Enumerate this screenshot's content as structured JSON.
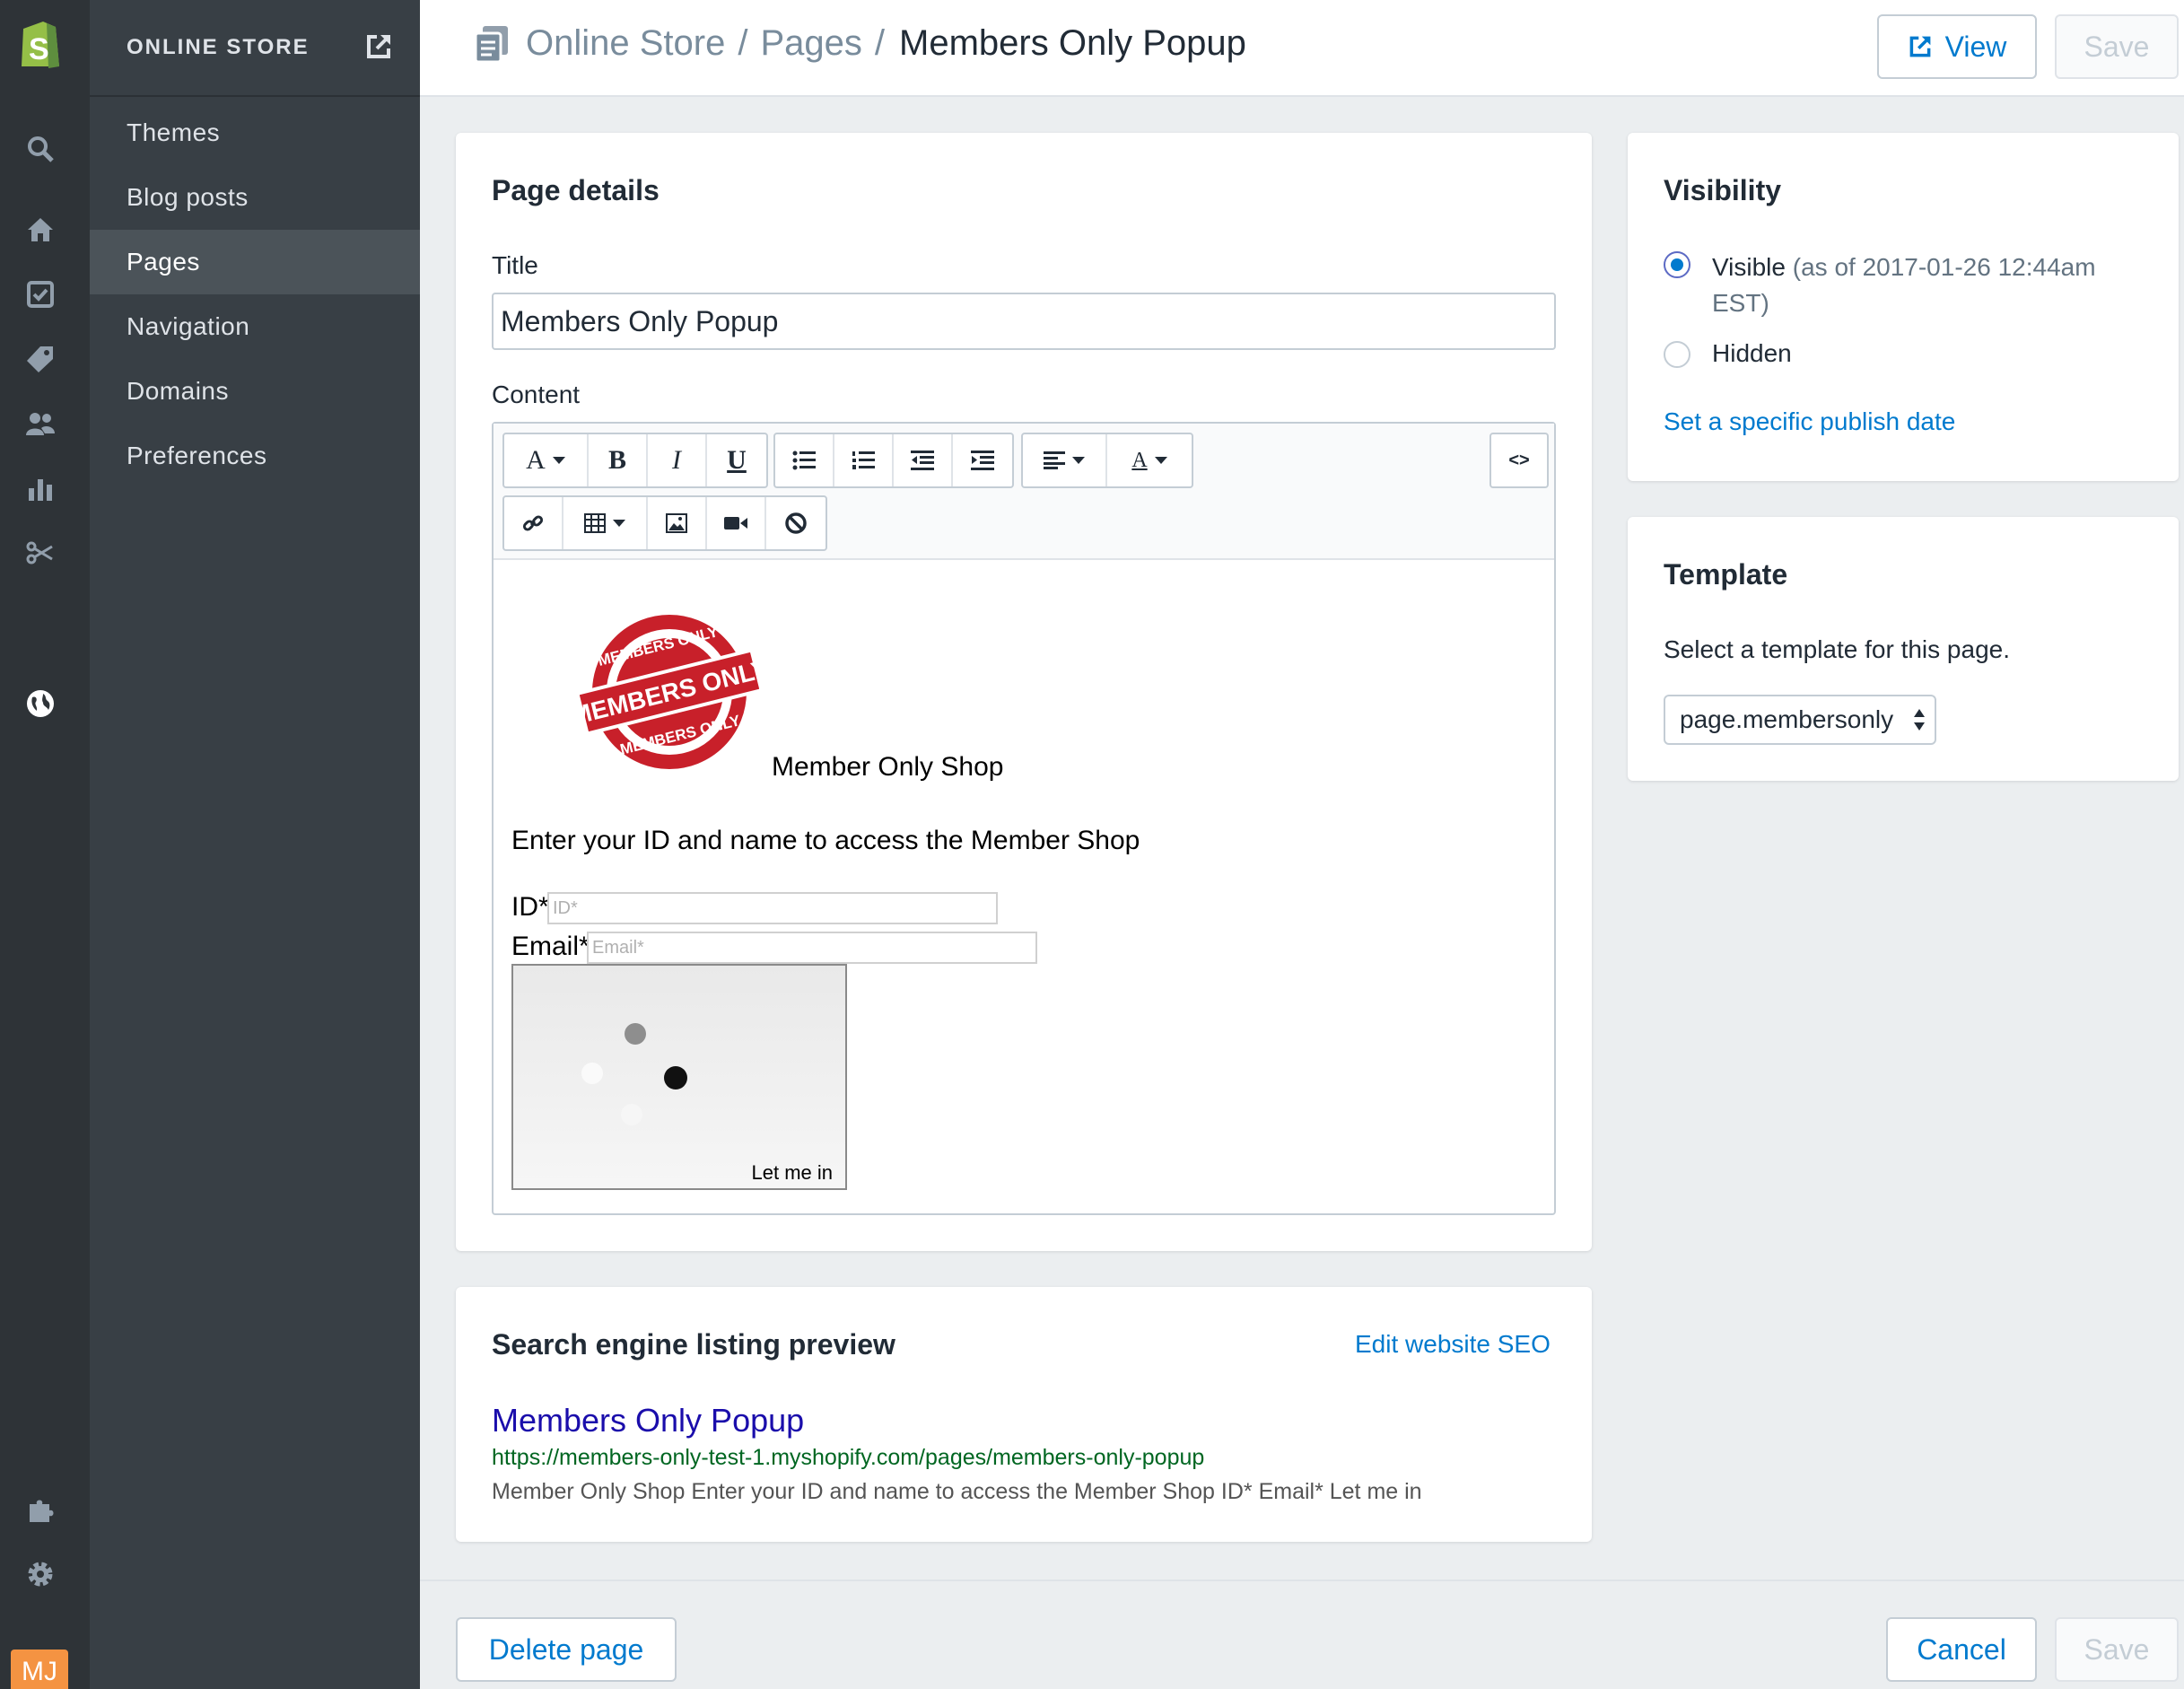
{
  "sidebar": {
    "section_title": "ONLINE STORE",
    "items": [
      {
        "label": "Themes"
      },
      {
        "label": "Blog posts"
      },
      {
        "label": "Pages",
        "active": true
      },
      {
        "label": "Navigation"
      },
      {
        "label": "Domains"
      },
      {
        "label": "Preferences"
      }
    ],
    "rail_icons": [
      "shopify-logo-icon",
      "search-icon",
      "home-icon",
      "orders-icon",
      "products-tag-icon",
      "customers-icon",
      "reports-icon",
      "discounts-icon",
      "online-store-globe-icon",
      "apps-puzzle-icon",
      "settings-gear-icon"
    ],
    "avatar_initials": "MJ",
    "brand_color": "#95bf47",
    "avatar_color": "#f49342"
  },
  "header": {
    "breadcrumb_1": "Online Store",
    "sep_1": "/",
    "breadcrumb_2": "Pages",
    "sep_2": "/",
    "current": "Members Only Popup",
    "view_label": "View",
    "save_label": "Save"
  },
  "page_details": {
    "heading": "Page details",
    "title_label": "Title",
    "title_value": "Members Only Popup",
    "content_label": "Content",
    "toolbar": {
      "format": "A",
      "bold": "B",
      "italic": "I",
      "underline": "U",
      "color": "A",
      "html": "<>"
    },
    "content": {
      "badge_text_top": "MEMBERS ONLY",
      "badge_text_middle": "MEMBERS ONLY",
      "badge_text_bottom": "MEMBERS ONLY",
      "shop_title": "Member Only Shop",
      "intro": "Enter your ID and name to access the Member Shop",
      "id_label": "ID*",
      "id_placeholder": "ID*",
      "email_label": "Email*",
      "email_placeholder": "Email*",
      "submit_label": "Let me in"
    }
  },
  "seo": {
    "heading": "Search engine listing preview",
    "edit_link": "Edit website SEO",
    "title": "Members Only Popup",
    "url": "https://members-only-test-1.myshopify.com/pages/members-only-popup",
    "description": "Member Only Shop Enter your ID and name to access the Member Shop ID* Email* Let me in"
  },
  "visibility": {
    "heading": "Visibility",
    "visible_label": "Visible",
    "visible_note_1": " (as of 2017-01-26 12:44am",
    "visible_note_2": "EST)",
    "hidden_label": "Hidden",
    "publish_link": "Set a specific publish date",
    "selected": "visible"
  },
  "template": {
    "heading": "Template",
    "description": "Select a template for this page.",
    "selected": "page.membersonly"
  },
  "footer": {
    "delete_label": "Delete page",
    "cancel_label": "Cancel",
    "save_label": "Save"
  }
}
